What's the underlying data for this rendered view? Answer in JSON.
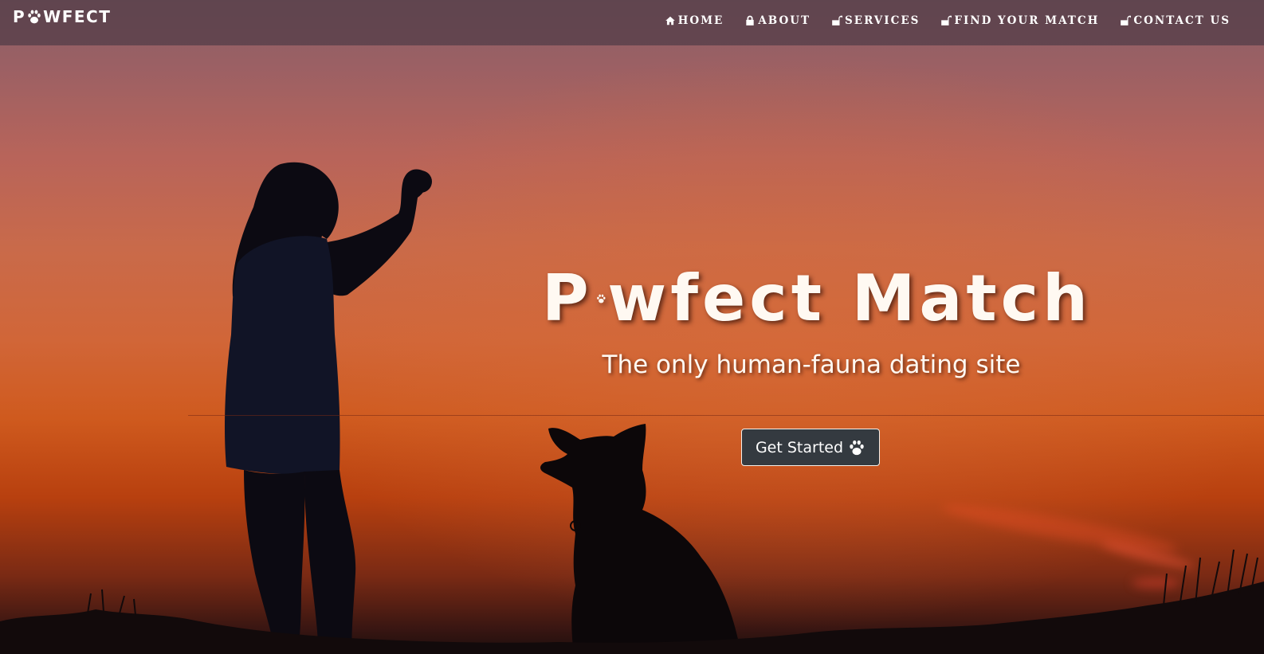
{
  "navbar": {
    "brand": {
      "prefix": "P",
      "icon": "paw-icon",
      "suffix": "WFECT"
    },
    "links": [
      {
        "label": "Home",
        "icon": "home-icon"
      },
      {
        "label": "About",
        "icon": "lock-icon"
      },
      {
        "label": "Services",
        "icon": "unlock-icon"
      },
      {
        "label": "Find Your Match",
        "icon": "unlock-icon"
      },
      {
        "label": "Contact Us",
        "icon": "unlock-icon"
      }
    ]
  },
  "hero": {
    "title_prefix": "P",
    "title_icon": "paw-icon",
    "title_suffix": "wfect Match",
    "subtitle": "The only human-fauna dating site",
    "cta_label": "Get Started",
    "cta_icon": "paw-icon"
  },
  "background": {
    "description_icon": "sunset-silhouette-image",
    "colors": {
      "sky_top": "#8a5e67",
      "sky_mid": "#d16638",
      "sky_low": "#b8400f",
      "ground": "#1c0e0d"
    }
  },
  "colors": {
    "navbar_bg": "#503c46",
    "cta_bg": "#343a40",
    "text": "#ffffff"
  }
}
